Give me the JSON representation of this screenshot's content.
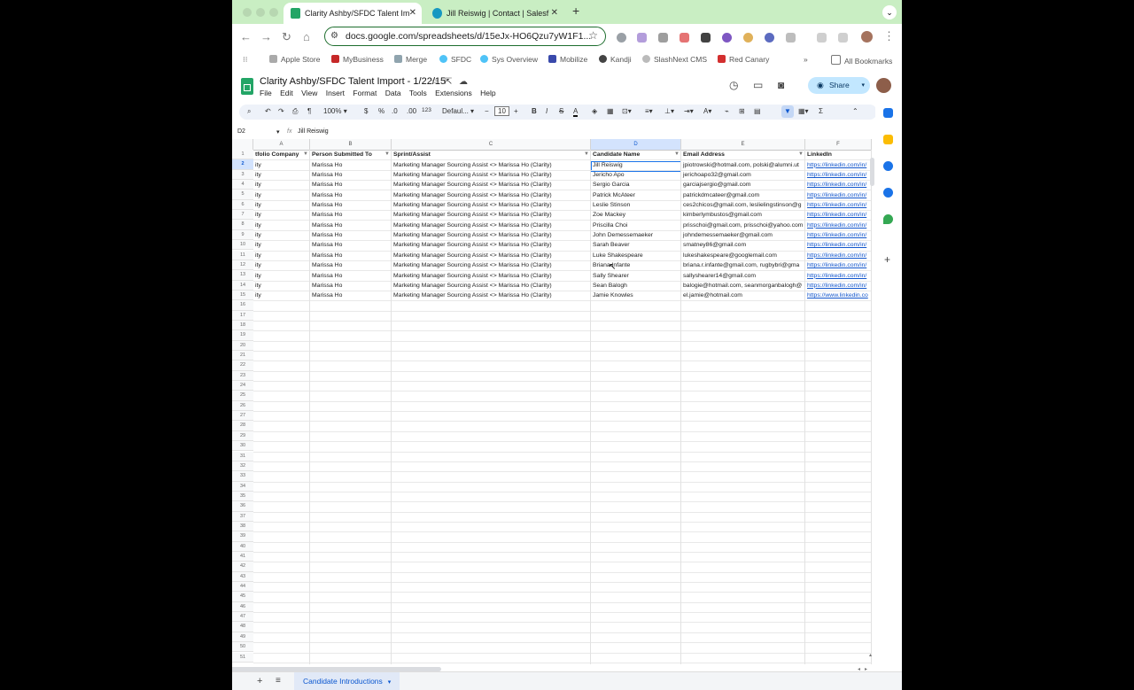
{
  "browser": {
    "tabs": [
      {
        "title": "Clarity Ashby/SFDC Talent Im",
        "active": true,
        "favicon_color": "#23a566"
      },
      {
        "title": "Jill Reiswig | Contact | Salesf",
        "active": false,
        "favicon_color": "#1798c1"
      }
    ],
    "url": "docs.google.com/spreadsheets/d/15eJx-HO6Qzu7yW1F1...",
    "bookmarks": [
      "Apple Store",
      "MyBusiness",
      "Merge",
      "SFDC",
      "Sys Overview",
      "Mobilize",
      "Kandji",
      "SlashNext CMS",
      "Red Canary"
    ],
    "all_bookmarks": "All Bookmarks"
  },
  "sheet": {
    "title": "Clarity Ashby/SFDC Talent Import - 1/22/15",
    "menu": [
      "File",
      "Edit",
      "View",
      "Insert",
      "Format",
      "Data",
      "Tools",
      "Extensions",
      "Help"
    ],
    "share_label": "Share",
    "zoom": "100%",
    "currency": "$",
    "percent": "%",
    "decimals_less": ".0",
    "decimals_more": ".00",
    "number_format": "123",
    "font": "Defaul...",
    "font_size": "10",
    "cell_ref": "D2",
    "formula": "Jill Reiswig",
    "columns": [
      "A",
      "B",
      "C",
      "D",
      "E",
      "F"
    ],
    "headers": [
      "tfolio Company",
      "Person Submitted To",
      "Sprint/Assist",
      "Candidate Name",
      "Email Address",
      "LinkedIn"
    ],
    "rows": [
      [
        "ity",
        "Marissa Ho",
        "Marketing Manager Sourcing Assist <> Marissa Ho (Clarity)",
        "Jill Reiswig",
        "jpiotrowski@hotmail.com, polski@alumni.ut",
        "https://linkedin.com/in/"
      ],
      [
        "ity",
        "Marissa Ho",
        "Marketing Manager Sourcing Assist <> Marissa Ho (Clarity)",
        "Jericho Apo",
        "jerichoapo32@gmail.com",
        "https://linkedin.com/in/"
      ],
      [
        "ity",
        "Marissa Ho",
        "Marketing Manager Sourcing Assist <> Marissa Ho (Clarity)",
        "Sergio Garcia",
        "garciajsergio@gmail.com",
        "https://linkedin.com/in/"
      ],
      [
        "ity",
        "Marissa Ho",
        "Marketing Manager Sourcing Assist <> Marissa Ho (Clarity)",
        "Patrick McAteer",
        "patrickdmcateer@gmail.com",
        "https://linkedin.com/in/"
      ],
      [
        "ity",
        "Marissa Ho",
        "Marketing Manager Sourcing Assist <> Marissa Ho (Clarity)",
        "Leslie Stinson",
        "ces2chicos@gmail.com, leslielingstinson@g",
        "https://linkedin.com/in/"
      ],
      [
        "ity",
        "Marissa Ho",
        "Marketing Manager Sourcing Assist <> Marissa Ho (Clarity)",
        "Zoe Mackey",
        "kimberlymbustos@gmail.com",
        "https://linkedin.com/in/"
      ],
      [
        "ity",
        "Marissa Ho",
        "Marketing Manager Sourcing Assist <> Marissa Ho (Clarity)",
        "Priscilla Choi",
        "prisschoi@gmail.com, prisschoi@yahoo.com",
        "https://linkedin.com/in/"
      ],
      [
        "ity",
        "Marissa Ho",
        "Marketing Manager Sourcing Assist <> Marissa Ho (Clarity)",
        "John Demessemaeker",
        "johndemessemaeker@gmail.com",
        "https://linkedin.com/in/"
      ],
      [
        "ity",
        "Marissa Ho",
        "Marketing Manager Sourcing Assist <> Marissa Ho (Clarity)",
        "Sarah Beaver",
        "smatney86@gmail.com",
        "https://linkedin.com/in/"
      ],
      [
        "ity",
        "Marissa Ho",
        "Marketing Manager Sourcing Assist <> Marissa Ho (Clarity)",
        "Luke Shakespeare",
        "lukeshakespeare@googlemail.com",
        "https://linkedin.com/in/"
      ],
      [
        "ity",
        "Marissa Ho",
        "Marketing Manager Sourcing Assist <> Marissa Ho (Clarity)",
        "Briana Infante",
        "briana.r.infante@gmail.com, rugbybri@gma",
        "https://linkedin.com/in/"
      ],
      [
        "ity",
        "Marissa Ho",
        "Marketing Manager Sourcing Assist <> Marissa Ho (Clarity)",
        "Sally Shearer",
        "sallyshearer14@gmail.com",
        "https://linkedin.com/in/"
      ],
      [
        "ity",
        "Marissa Ho",
        "Marketing Manager Sourcing Assist <> Marissa Ho (Clarity)",
        "Sean Balogh",
        "balogie@hotmail.com, seanmorganbalogh@",
        "https://linkedin.com/in/"
      ],
      [
        "ity",
        "Marissa Ho",
        "Marketing Manager Sourcing Assist <> Marissa Ho (Clarity)",
        "Jamie Knowles",
        "el.jamie@hotmail.com",
        "https://www.linkedin.co"
      ]
    ],
    "row_count": 51,
    "selected_row": 2,
    "selected_column": "D",
    "sheet_tab": "Candidate Introductions"
  },
  "colors": {
    "tabstrip": "#c9eec3",
    "accent": "#1a73e8",
    "share_bg": "#c2e7ff",
    "link": "#1155cc"
  }
}
